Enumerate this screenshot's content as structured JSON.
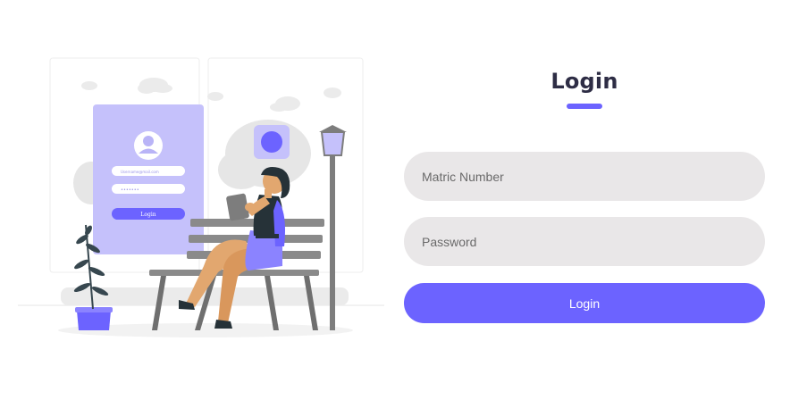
{
  "login": {
    "title": "Login",
    "matric_placeholder": "Matric Number",
    "password_placeholder": "Password",
    "submit_label": "Login"
  },
  "illustration": {
    "card_button_label": "Login",
    "card_username_text": "Username@mail.com",
    "card_password_text": "•••••••",
    "accent_color": "#6c63ff"
  }
}
